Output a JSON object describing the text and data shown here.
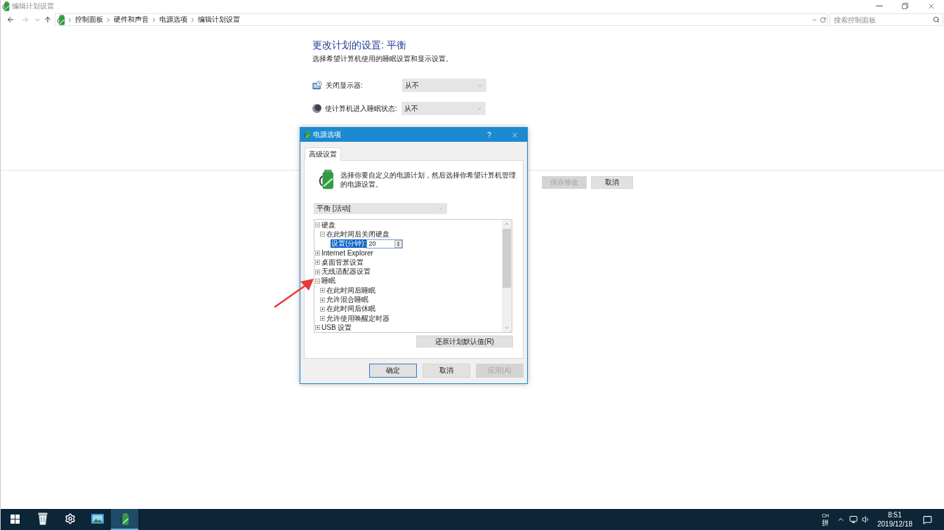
{
  "window": {
    "title": "编辑计划设置"
  },
  "address_bar": {
    "breadcrumbs": [
      "控制面板",
      "硬件和声音",
      "电源选项",
      "编辑计划设置"
    ],
    "search": {
      "placeholder": "搜索控制面板"
    }
  },
  "plan": {
    "heading": "更改计划的设置: 平衡",
    "description": "选择希望计算机使用的睡眠设置和显示设置。",
    "settings": [
      {
        "kind": "display",
        "label": "关闭显示器:",
        "value": "从不"
      },
      {
        "kind": "sleep",
        "label": "使计算机进入睡眠状态:",
        "value": "从不"
      }
    ],
    "buttons": [
      {
        "label": "保存修改",
        "disabled": true
      },
      {
        "label": "取消",
        "disabled": false
      }
    ]
  },
  "dialog": {
    "title": "电源选项",
    "help": "?",
    "tabs": [
      {
        "label": "高级设置",
        "selected": true
      }
    ],
    "intro": "选择你要自定义的电源计划，然后选择你希望计算机管理的电源设置。",
    "plan": "平衡 [活动]",
    "tree": [
      {
        "kind": "group",
        "label": "硬盘",
        "expanded": true,
        "selected": false,
        "children": [
          {
            "kind": "group",
            "label": "在此时间后关闭硬盘",
            "expanded": true,
            "selected": false,
            "children": [
              {
                "kind": "setting",
                "label": "设置(分钟):",
                "value": "20",
                "selected": true
              }
            ]
          }
        ]
      },
      {
        "kind": "group",
        "label": "Internet Explorer",
        "expanded": false,
        "selected": false
      },
      {
        "kind": "group",
        "label": "桌面背景设置",
        "expanded": false,
        "selected": false
      },
      {
        "kind": "group",
        "label": "无线适配器设置",
        "expanded": false,
        "selected": false
      },
      {
        "kind": "group",
        "label": "睡眠",
        "expanded": true,
        "selected": false,
        "children": [
          {
            "kind": "group",
            "label": "在此时间后睡眠",
            "expanded": false,
            "selected": false
          },
          {
            "kind": "group",
            "label": "允许混合睡眠",
            "expanded": false,
            "selected": false
          },
          {
            "kind": "group",
            "label": "在此时间后休眠",
            "expanded": false,
            "selected": false
          },
          {
            "kind": "group",
            "label": "允许使用唤醒定时器",
            "expanded": false,
            "selected": false
          }
        ]
      },
      {
        "kind": "group",
        "label": "USB 设置",
        "expanded": false,
        "selected": false
      }
    ],
    "restore_button": "还原计划默认值(R)",
    "buttons": [
      {
        "label": "确定",
        "kind": "default",
        "disabled": false
      },
      {
        "label": "取消",
        "kind": "normal",
        "disabled": false
      },
      {
        "label": "应用(A)",
        "kind": "normal",
        "disabled": true
      }
    ]
  },
  "taskbar": {
    "apps": [
      {
        "kind": "recycle_bin",
        "selected": false
      },
      {
        "kind": "settings",
        "selected": false
      },
      {
        "kind": "photos",
        "selected": false
      },
      {
        "kind": "power_options",
        "selected": true
      }
    ],
    "input_language": "CH",
    "input_mode": "拼",
    "time": "8:51",
    "date": "2019/12/18"
  }
}
